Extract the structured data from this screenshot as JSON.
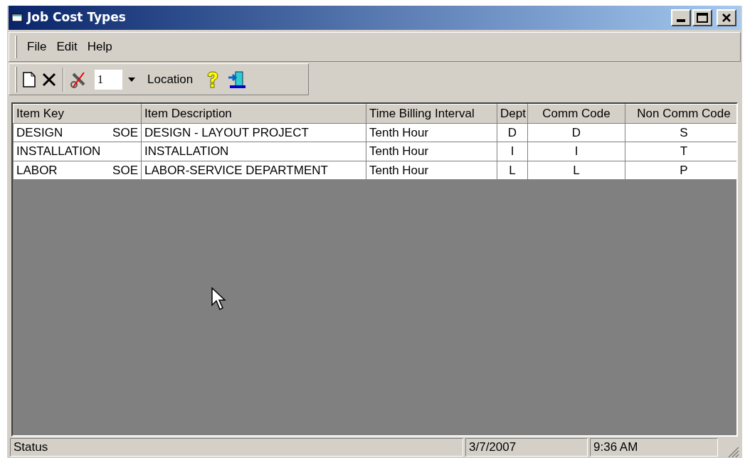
{
  "window": {
    "title": "Job Cost Types"
  },
  "menu": [
    "File",
    "Edit",
    "Help"
  ],
  "toolbar": {
    "location_value": "1",
    "location_label": "Location"
  },
  "table": {
    "columns": [
      "Item Key",
      "Item Description",
      "Time Billing Interval",
      "Dept",
      "Comm Code",
      "Non Comm Code"
    ],
    "rows": [
      {
        "key": "DESIGN",
        "key_suffix": "SOE",
        "description": "DESIGN - LAYOUT PROJECT",
        "interval": "Tenth Hour",
        "dept": "D",
        "comm": "D",
        "noncomm": "S"
      },
      {
        "key": "INSTALLATION",
        "description": "INSTALLATION",
        "interval": "Tenth Hour",
        "dept": "I",
        "comm": "I",
        "noncomm": "T"
      },
      {
        "key": "LABOR",
        "key_suffix": "SOE",
        "description": "LABOR-SERVICE DEPARTMENT",
        "interval": "Tenth Hour",
        "dept": "L",
        "comm": "L",
        "noncomm": "P"
      }
    ]
  },
  "status_bar": [
    "Status",
    "3/7/2007",
    "9:36 AM"
  ]
}
